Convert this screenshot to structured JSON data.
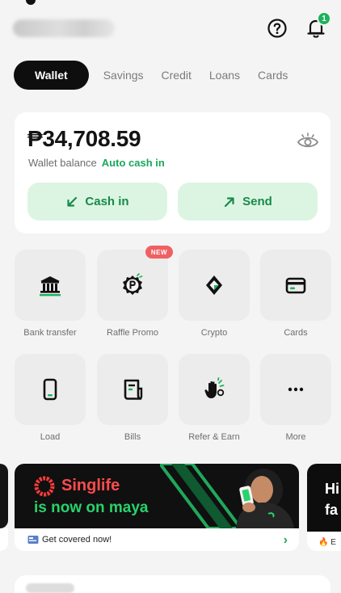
{
  "header": {
    "username": "user",
    "notification_count": "1"
  },
  "tabs": [
    {
      "label": "Wallet",
      "active": true
    },
    {
      "label": "Savings"
    },
    {
      "label": "Credit"
    },
    {
      "label": "Loans"
    },
    {
      "label": "Cards"
    }
  ],
  "balance": {
    "amount": "₱34,708.59",
    "label": "Wallet balance",
    "auto_cash_in": "Auto cash in",
    "cash_in_label": "Cash in",
    "send_label": "Send"
  },
  "services": [
    {
      "label": "Bank transfer",
      "icon": "bank-icon"
    },
    {
      "label": "Raffle Promo",
      "icon": "raffle-icon",
      "badge": "NEW"
    },
    {
      "label": "Crypto",
      "icon": "crypto-icon"
    },
    {
      "label": "Cards",
      "icon": "card-icon"
    },
    {
      "label": "Load",
      "icon": "phone-icon"
    },
    {
      "label": "Bills",
      "icon": "bills-icon"
    },
    {
      "label": "Refer & Earn",
      "icon": "refer-icon"
    },
    {
      "label": "More",
      "icon": "more-icon"
    }
  ],
  "banners": [
    {
      "brand": "Singlife",
      "tagline": "is now on maya",
      "cta": "Get covered now!"
    },
    {
      "text": "Hi\nfa",
      "cta": "🔥 E"
    }
  ],
  "colors": {
    "accent_green": "#1aa75a",
    "action_bg": "#dcf5e3",
    "tab_active_bg": "#0e0e0e",
    "badge_red": "#f06062"
  }
}
